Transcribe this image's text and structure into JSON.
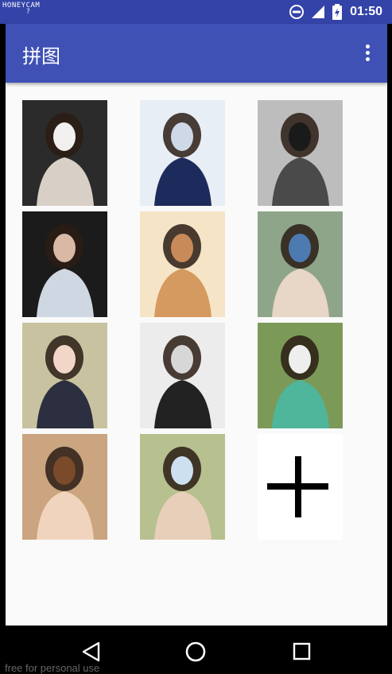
{
  "status_bar": {
    "watermark": "HONEYCAM",
    "time": "01:50",
    "icons": [
      "wifi-icon",
      "do-not-disturb-icon",
      "signal-icon",
      "battery-charging-icon"
    ]
  },
  "app_bar": {
    "title": "拼图",
    "overflow_icon": "more-vert-icon"
  },
  "grid": {
    "photos": [
      {
        "name": "photo-1",
        "colors": [
          "#2b2b2b",
          "#d8cfc6",
          "#f2f0ee"
        ]
      },
      {
        "name": "photo-2",
        "colors": [
          "#e8eef5",
          "#1d2b5c",
          "#cfd8e6"
        ]
      },
      {
        "name": "photo-3",
        "colors": [
          "#bdbdbd",
          "#4a4a4a",
          "#1a1a1a"
        ]
      },
      {
        "name": "photo-4",
        "colors": [
          "#1b1b1b",
          "#cfd7e2",
          "#d9b9a5"
        ]
      },
      {
        "name": "photo-5",
        "colors": [
          "#f6e4c7",
          "#d59a5f",
          "#c88a58"
        ]
      },
      {
        "name": "photo-6",
        "colors": [
          "#8fa58a",
          "#e8d6c6",
          "#4d7ab0"
        ]
      },
      {
        "name": "photo-7",
        "colors": [
          "#c8c2a0",
          "#2b2f3f",
          "#f2d7c8"
        ]
      },
      {
        "name": "photo-8",
        "colors": [
          "#ececec",
          "#222222",
          "#d7d7d7"
        ]
      },
      {
        "name": "photo-9",
        "colors": [
          "#7b9a58",
          "#4fb59b",
          "#eeeeee"
        ]
      },
      {
        "name": "photo-10",
        "colors": [
          "#caa57f",
          "#f1d4bd",
          "#7a4a2a"
        ]
      },
      {
        "name": "photo-11",
        "colors": [
          "#b7c08f",
          "#e8cfb9",
          "#cde0f0"
        ]
      }
    ],
    "add_button_icon": "plus-icon"
  },
  "nav_bar": {
    "footer_text": "free for personal use",
    "buttons": [
      "back-icon",
      "home-icon",
      "recents-icon"
    ]
  }
}
